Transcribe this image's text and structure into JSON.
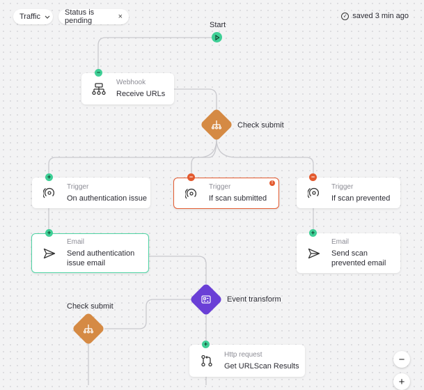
{
  "toolbar": {
    "filter_traffic": "Traffic",
    "filter_status": "Status is pending",
    "saved_text": "saved 3 min ago"
  },
  "flow": {
    "start_label": "Start",
    "webhook": {
      "sub": "Webhook",
      "main": "Receive URLs"
    },
    "check_submit_1": "Check submit",
    "trigger_auth": {
      "sub": "Trigger",
      "main": "On authentication issue"
    },
    "trigger_submitted": {
      "sub": "Trigger",
      "main": "If scan submitted",
      "alert": "!"
    },
    "trigger_prevented": {
      "sub": "Trigger",
      "main": "If scan prevented"
    },
    "email_auth": {
      "sub": "Email",
      "main_line1": "Send authentication",
      "main_line2": "issue email"
    },
    "email_prevented": {
      "sub": "Email",
      "main_line1": "Send scan",
      "main_line2": "prevented email"
    },
    "event_transform": "Event transform",
    "check_submit_2": "Check submit",
    "http_request": {
      "sub": "Http request",
      "main": "Get URLScan Results"
    }
  },
  "zoom": {
    "out": "−",
    "in": "+"
  },
  "colors": {
    "accent_green": "#3fcf96",
    "error_red": "#e35a2f",
    "split_orange": "#d58a44",
    "transform_purple": "#6a3fd6"
  }
}
